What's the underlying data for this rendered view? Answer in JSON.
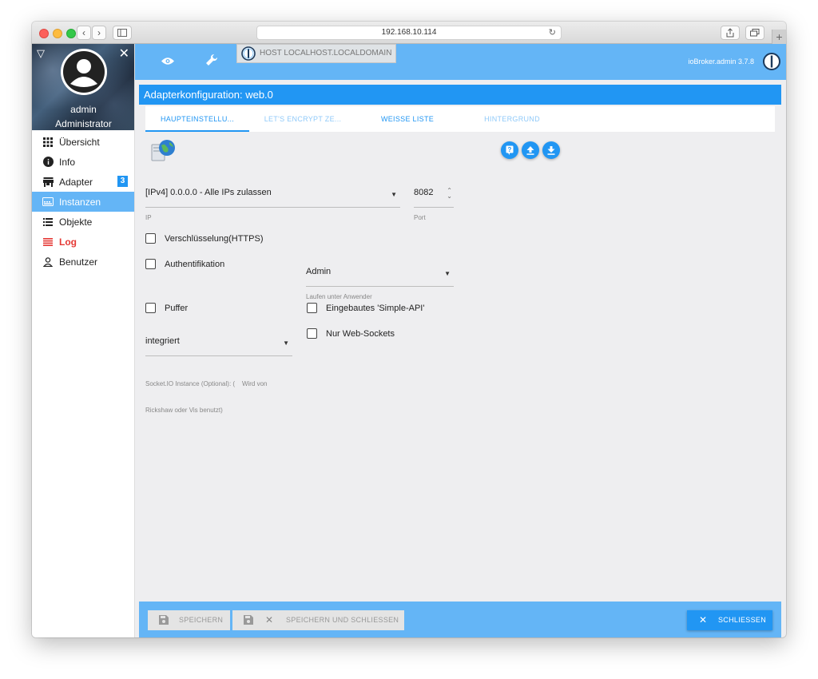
{
  "browser": {
    "url": "192.168.10.114"
  },
  "sidebar": {
    "user_name": "admin",
    "user_role": "Administrator",
    "items": [
      {
        "label": "Übersicht",
        "icon": "grid-icon"
      },
      {
        "label": "Info",
        "icon": "info-icon"
      },
      {
        "label": "Adapter",
        "icon": "store-icon",
        "badge": "3"
      },
      {
        "label": "Instanzen",
        "icon": "instances-icon",
        "active": true
      },
      {
        "label": "Objekte",
        "icon": "list-icon"
      },
      {
        "label": "Log",
        "icon": "menu-lines-icon",
        "highlight": "#e53935"
      },
      {
        "label": "Benutzer",
        "icon": "user-icon"
      }
    ]
  },
  "appbar": {
    "host_tab": "HOST LOCALHOST.LOCALDOMAIN",
    "version": "ioBroker.admin 3.7.8"
  },
  "config": {
    "title": "Adapterkonfiguration: web.0",
    "tabs": [
      {
        "label": "HAUPTEINSTELLU...",
        "active": true
      },
      {
        "label": "LET'S ENCRYPT ZE..."
      },
      {
        "label": "WEISSE LISTE"
      },
      {
        "label": "HINTERGRUND"
      }
    ],
    "ip_select": {
      "value": "[IPv4] 0.0.0.0 - Alle IPs zulassen",
      "label": "IP"
    },
    "port": {
      "value": "8082",
      "label": "Port"
    },
    "checkboxes": {
      "https": "Verschlüsselung(HTTPS)",
      "auth": "Authentifikation",
      "cache": "Puffer",
      "simple_api": "Eingebautes 'Simple-API'",
      "web_sockets": "Nur Web-Sockets"
    },
    "run_as": {
      "value": "Admin",
      "label": "Laufen unter Anwender"
    },
    "socketio": {
      "value": "integriert",
      "helper_line1": "Socket.IO Instance (Optional): (    Wird von",
      "helper_line2": "Rickshaw oder Vis benutzt)"
    }
  },
  "footer": {
    "save": "SPEICHERN",
    "save_close": "SPEICHERN UND SCHLIESSEN",
    "close": "SCHLIESSEN"
  },
  "colors": {
    "primary": "#2196f3",
    "bar": "#64b5f6",
    "log": "#e53935"
  }
}
